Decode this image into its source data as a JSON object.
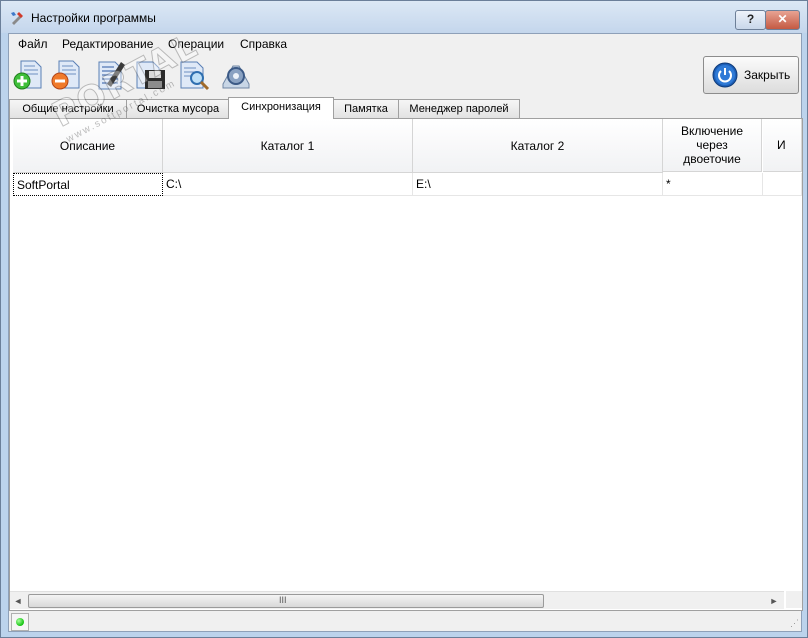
{
  "window": {
    "title": "Настройки программы",
    "help_label": "?",
    "close_label": "✕"
  },
  "menu": [
    "Файл",
    "Редактирование",
    "Операции",
    "Справка"
  ],
  "toolbar": {
    "icons": [
      "add-icon",
      "remove-icon",
      "edit-icon",
      "save-icon",
      "search-icon",
      "settings-icon"
    ],
    "close_button_label": "Закрыть"
  },
  "tabs": [
    {
      "label": "Общие настройки",
      "active": false
    },
    {
      "label": "Очистка мусора",
      "active": false
    },
    {
      "label": "Синхронизация",
      "active": true
    },
    {
      "label": "Памятка",
      "active": false
    },
    {
      "label": "Менеджер паролей",
      "active": false
    }
  ],
  "grid": {
    "columns": [
      "Описание",
      "Каталог 1",
      "Каталог 2",
      "Включение через двоеточие",
      "И"
    ],
    "rows": [
      [
        "SoftPortal",
        "C:\\",
        "E:\\",
        "*",
        ""
      ]
    ]
  },
  "scrollbar": {
    "grip": "III",
    "left_arrow": "◄",
    "right_arrow": "►"
  },
  "status": {
    "indicator_color": "#14c210"
  },
  "watermark": {
    "text": "PORTAL",
    "subtext": "www.softportal.com"
  }
}
